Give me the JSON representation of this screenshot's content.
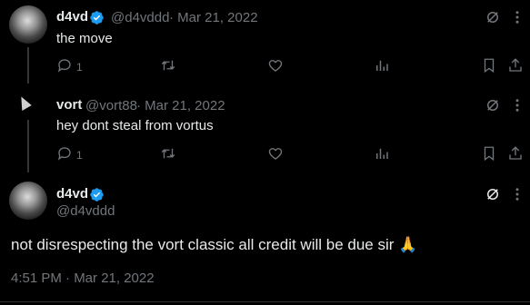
{
  "tweet1": {
    "author": "d4vd",
    "handle": "@d4vddd",
    "date": "· Mar 21, 2022",
    "text": "the move",
    "reply_count": "1"
  },
  "tweet2": {
    "author": "vort",
    "handle": "@vort88",
    "date": "· Mar 21, 2022",
    "text": "hey dont steal from vortus",
    "reply_count": "1"
  },
  "main": {
    "author": "d4vd",
    "handle": "@d4vddd",
    "text": "not disrespecting the vort classic all credit will be due sir 🙏",
    "timestamp": "4:51 PM · Mar 21, 2022"
  },
  "colors": {
    "verified": "#1d9bf0",
    "muted": "#71767b",
    "text": "#e7e9ea"
  },
  "icons": [
    "reply-icon",
    "retweet-icon",
    "like-icon",
    "views-icon",
    "bookmark-icon",
    "share-icon",
    "grok-icon",
    "more-icon",
    "verified-badge-icon"
  ]
}
